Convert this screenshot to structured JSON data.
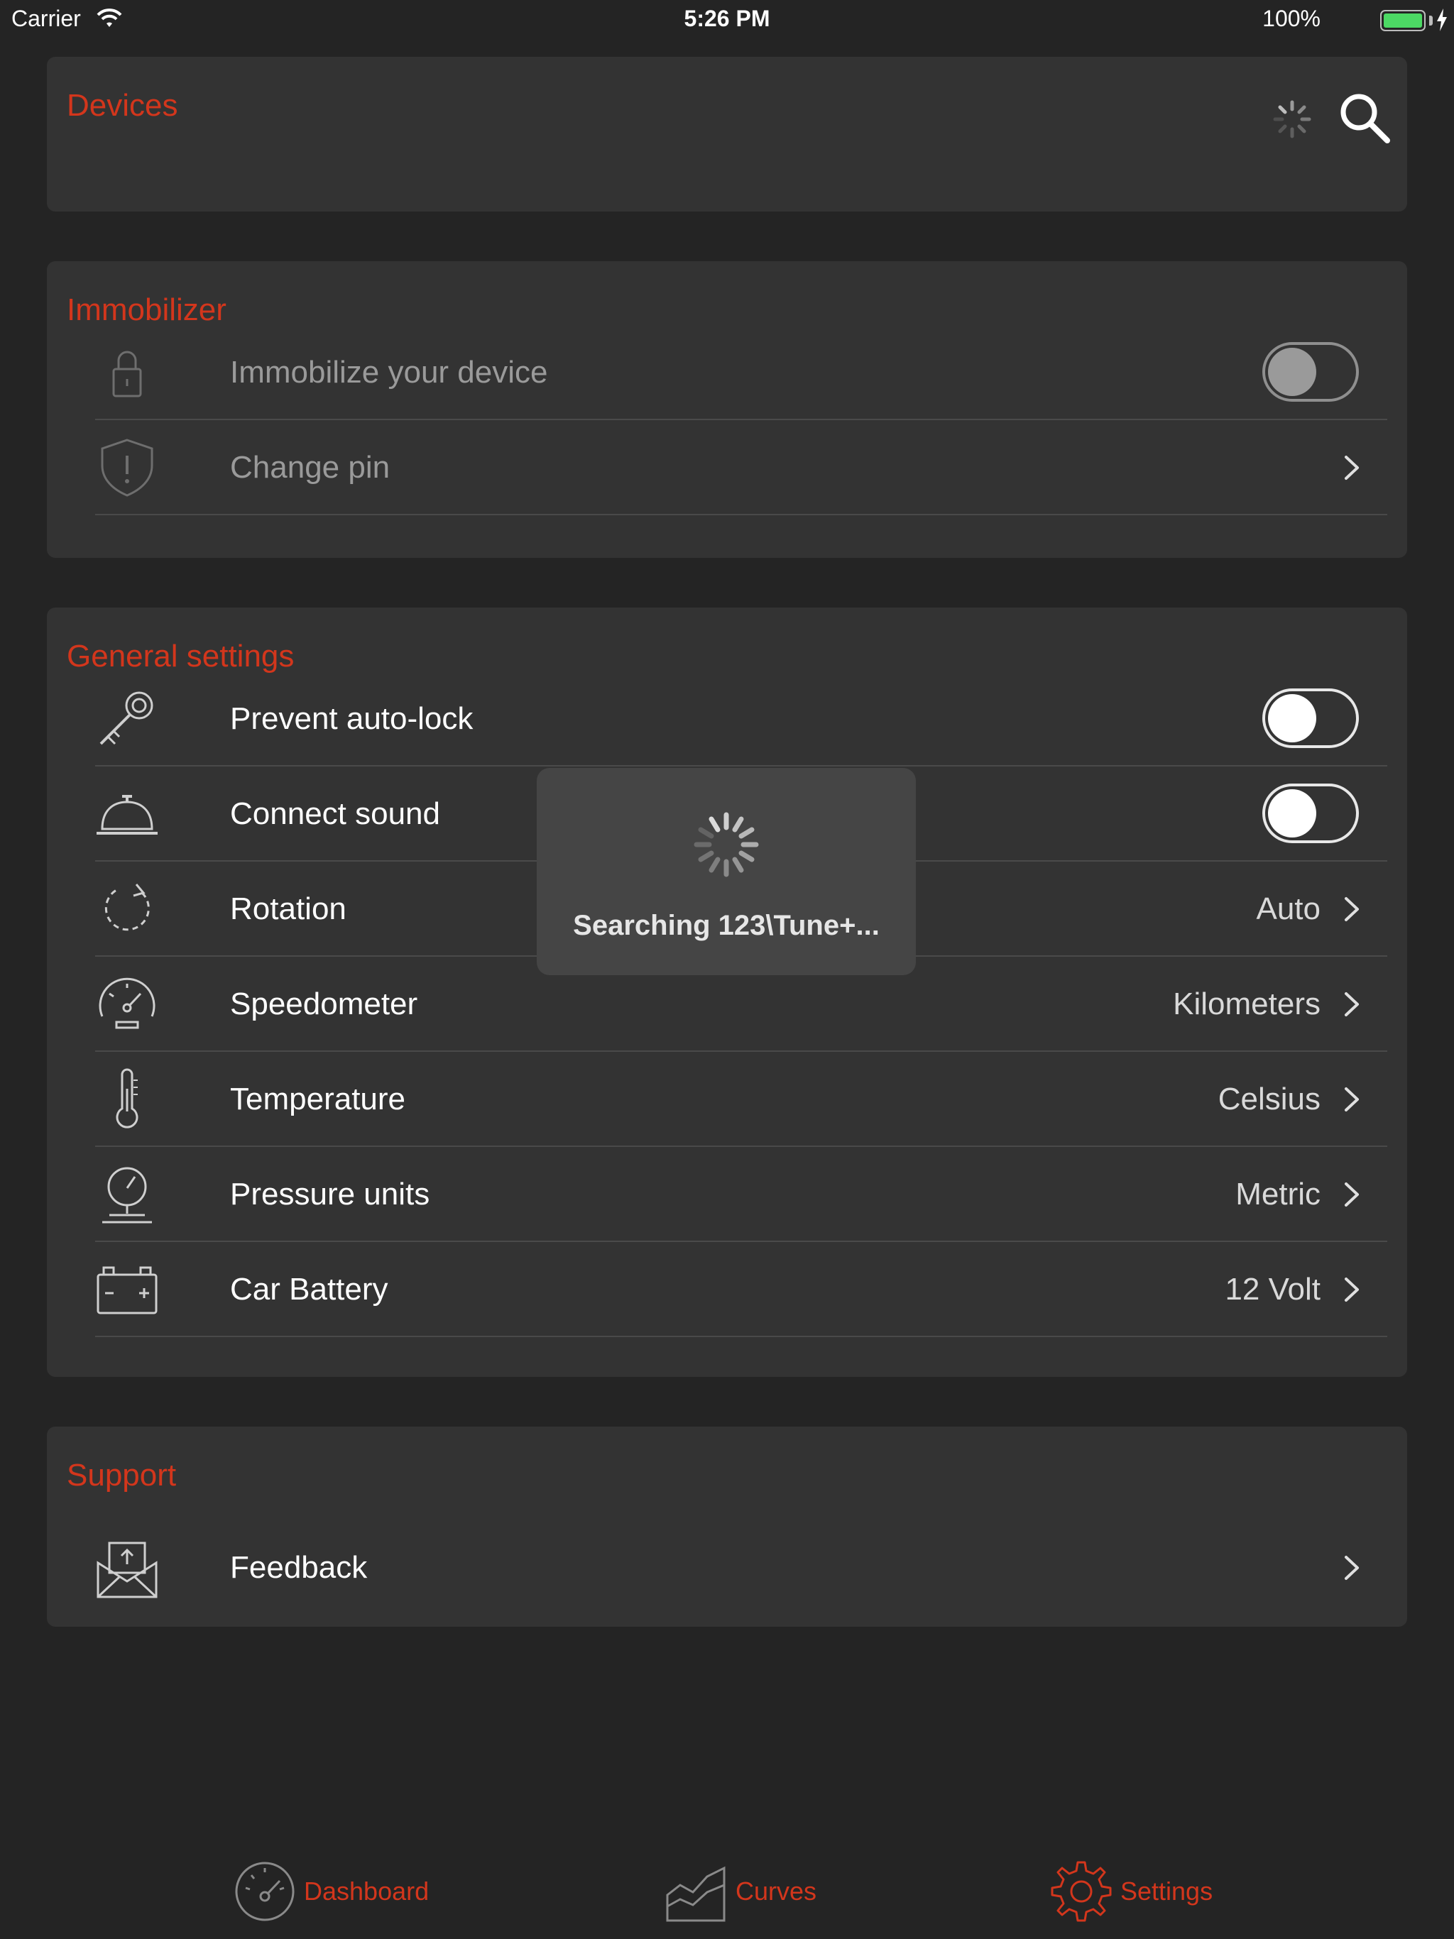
{
  "status_bar": {
    "carrier": "Carrier",
    "time": "5:26 PM",
    "battery": "100%"
  },
  "devices": {
    "title": "Devices"
  },
  "immobilizer": {
    "title": "Immobilizer",
    "immobilize_label": "Immobilize your device",
    "immobilize_on": false,
    "change_pin_label": "Change pin"
  },
  "general": {
    "title": "General settings",
    "prevent_autolock_label": "Prevent auto-lock",
    "connect_sound_label": "Connect sound",
    "rotation_label": "Rotation",
    "rotation_value": "Auto",
    "speedometer_label": "Speedometer",
    "speedometer_value": "Kilometers",
    "temperature_label": "Temperature",
    "temperature_value": "Celsius",
    "pressure_label": "Pressure units",
    "pressure_value": "Metric",
    "battery_label": "Car Battery",
    "battery_value": "12 Volt"
  },
  "support": {
    "title": "Support",
    "feedback_label": "Feedback"
  },
  "hud": {
    "text": "Searching 123\\Tune+..."
  },
  "tabbar": {
    "dashboard": "Dashboard",
    "curves": "Curves",
    "settings": "Settings"
  },
  "colors": {
    "accent": "#d3361c",
    "background": "#242424",
    "card": "#333333"
  }
}
